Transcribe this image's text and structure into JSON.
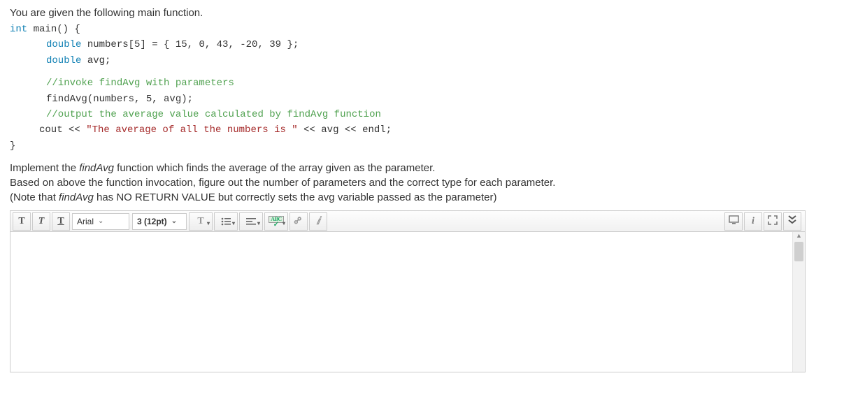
{
  "question": {
    "intro": "You are given the following main function.",
    "code": {
      "l1_a": "int",
      "l1_b": " main() {",
      "l2_a": "double",
      "l2_b": " numbers[5] = { 15, 0, 43, -20, 39 };",
      "l3_a": "double",
      "l3_b": " avg;",
      "l4": "//invoke findAvg with parameters",
      "l5": "findAvg(numbers, 5, avg);",
      "l6": "//output the average value calculated by findAvg function",
      "l7_a": "cout << ",
      "l7_b": "\"The average of all the numbers is \"",
      "l7_c": " << avg << endl;",
      "l8": "}"
    },
    "instr1_a": "Implement the ",
    "instr1_b": "findAvg",
    "instr1_c": " function which finds the average of the array given as the parameter.",
    "instr2": "Based on above the function invocation, figure out the number of parameters and the correct type for each parameter.",
    "instr3_a": "(Note that ",
    "instr3_b": "findAvg",
    "instr3_c": " has NO RETURN VALUE but correctly sets the avg variable passed as the parameter)"
  },
  "toolbar": {
    "font_family": "Arial",
    "font_size": "3 (12pt)"
  }
}
